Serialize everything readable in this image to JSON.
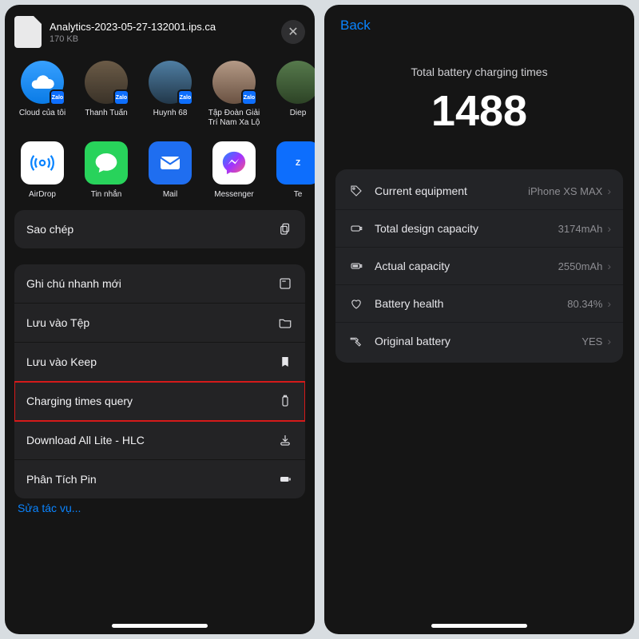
{
  "left": {
    "file": {
      "name": "Analytics-2023-05-27-132001.ips.ca",
      "size": "170 KB"
    },
    "contacts": [
      {
        "label": "Cloud của tôi"
      },
      {
        "label": "Thanh Tuấn"
      },
      {
        "label": "Huynh 68"
      },
      {
        "label": "Tập Đoàn Giải Trí Nam Xa Lộ"
      },
      {
        "label": "Diep"
      }
    ],
    "apps": [
      {
        "label": "AirDrop"
      },
      {
        "label": "Tin nhắn"
      },
      {
        "label": "Mail"
      },
      {
        "label": "Messenger"
      },
      {
        "label": "Te"
      }
    ],
    "copy": "Sao chép",
    "actions": [
      {
        "label": "Ghi chú nhanh mới"
      },
      {
        "label": "Lưu vào Tệp"
      },
      {
        "label": "Lưu vào Keep"
      },
      {
        "label": "Charging times query"
      },
      {
        "label": "Download All Lite - HLC"
      },
      {
        "label": "Phân Tích Pin"
      }
    ],
    "edit": "Sửa tác vụ..."
  },
  "right": {
    "back": "Back",
    "metric_label": "Total battery charging times",
    "metric_value": "1488",
    "stats": {
      "equipment": {
        "label": "Current equipment",
        "value": "iPhone XS MAX"
      },
      "design": {
        "label": "Total design capacity",
        "value": "3174mAh"
      },
      "actual": {
        "label": "Actual capacity",
        "value": "2550mAh"
      },
      "health": {
        "label": "Battery health",
        "value": "80.34%"
      },
      "original": {
        "label": "Original battery",
        "value": "YES"
      }
    }
  }
}
